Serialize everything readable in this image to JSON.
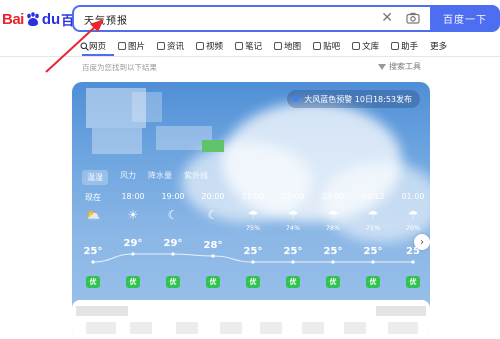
{
  "logo": {
    "left": "Bai",
    "right": "du",
    "cn": "百度"
  },
  "search": {
    "query": "天气预报",
    "button": "百度一下"
  },
  "tabs": [
    {
      "label": "网页",
      "icon": "search-icon"
    },
    {
      "label": "图片",
      "icon": "image-icon"
    },
    {
      "label": "资讯",
      "icon": "news-icon"
    },
    {
      "label": "视频",
      "icon": "video-icon"
    },
    {
      "label": "笔记",
      "icon": "note-icon"
    },
    {
      "label": "地图",
      "icon": "map-icon"
    },
    {
      "label": "贴吧",
      "icon": "tieba-icon"
    },
    {
      "label": "文库",
      "icon": "doc-icon"
    },
    {
      "label": "助手",
      "icon": "assistant-icon"
    },
    {
      "label": "更多",
      "icon": ""
    }
  ],
  "result_info": "百度为您找到以下结果",
  "tools": "搜索工具",
  "weather": {
    "alert": "大风蓝色预警  10日18:53发布",
    "subtabs": [
      "温湿",
      "风力",
      "降水量",
      "紫外线"
    ],
    "times": [
      "现在",
      "18:00",
      "19:00",
      "20:00",
      "21:00",
      "22:00",
      "23:00",
      "09/12",
      "01:00"
    ],
    "icons": [
      "partly-sunny-icon",
      "sun-icon",
      "moon-icon",
      "moon-icon",
      "rain-icon",
      "rain-icon",
      "rain-icon",
      "rain-icon",
      "rain-icon"
    ],
    "probs": [
      "",
      "",
      "",
      "",
      "75%",
      "74%",
      "78%",
      "71%",
      "70%"
    ],
    "temps": [
      "25°",
      "29°",
      "29°",
      "28°",
      "25°",
      "25°",
      "25°",
      "25°",
      "25"
    ],
    "aqi": [
      "优",
      "优",
      "优",
      "优",
      "优",
      "优",
      "优",
      "优",
      "优"
    ]
  },
  "colors": {
    "brand": "#4e6ef2",
    "aqi_good": "#31c14e",
    "annotation_arrow": "#e8262f"
  }
}
